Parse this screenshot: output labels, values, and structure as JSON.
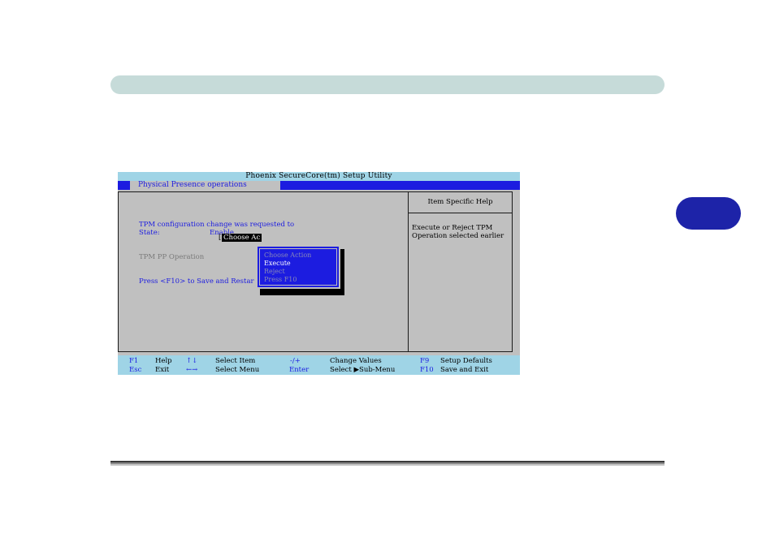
{
  "bios": {
    "title": "Phoenix SecureCore(tm) Setup Utility",
    "tab": "Physical Presence operations",
    "content": {
      "message_line1": "TPM configuration change was requested to",
      "state_label": "State:",
      "state_value": "Enable",
      "operation_label": "TPM PP Operation",
      "operation_value": "Choose Ac",
      "bracket_open": "[",
      "save_hint": "Press <F10> to Save and Restar"
    },
    "popup": {
      "options": [
        "Choose Action",
        "Execute",
        "Reject",
        "Press F10"
      ]
    },
    "help": {
      "header": "Item Specific Help",
      "text": "Execute or Reject TPM Operation selected earlier"
    },
    "footer": {
      "row1": [
        {
          "key": "F1",
          "desc": "Help"
        },
        {
          "key": "↑↓",
          "desc": "Select Item"
        },
        {
          "key": "-/+",
          "desc": "Change Values"
        },
        {
          "key": "F9",
          "desc": "Setup Defaults"
        }
      ],
      "row2": [
        {
          "key": "Esc",
          "desc": "Exit"
        },
        {
          "key": "←→",
          "desc": "Select Menu"
        },
        {
          "key": "Enter",
          "desc": "Select ▶Sub-Menu"
        },
        {
          "key": "F10",
          "desc": "Save and Exit"
        }
      ]
    }
  },
  "colors": {
    "title_bar": "#9fd4e6",
    "menu_band": "#1c1ce0",
    "background": "#c0c0c0",
    "chapter_tab": "#1d23a8",
    "header_bar": "#c6dbd9"
  }
}
